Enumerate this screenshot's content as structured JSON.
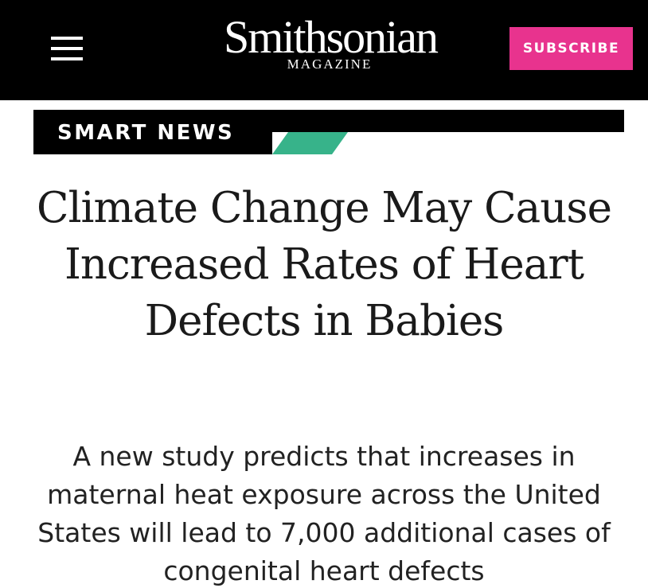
{
  "header": {
    "logo": {
      "name": "Smithsonian",
      "sub": "MAGAZINE"
    },
    "subscribe_label": "SUBSCRIBE",
    "menu_icon": "hamburger-menu-icon",
    "colors": {
      "background": "#000000",
      "subscribe": "#e8338e"
    }
  },
  "section": {
    "label": "SMART NEWS",
    "accent_color": "#37b38a"
  },
  "article": {
    "headline": "Climate Change May Cause Increased Rates of Heart Defects in Babies",
    "dek": "A new study predicts that increases in maternal heat exposure across the United States will lead to 7,000 additional cases of congenital heart defects"
  }
}
